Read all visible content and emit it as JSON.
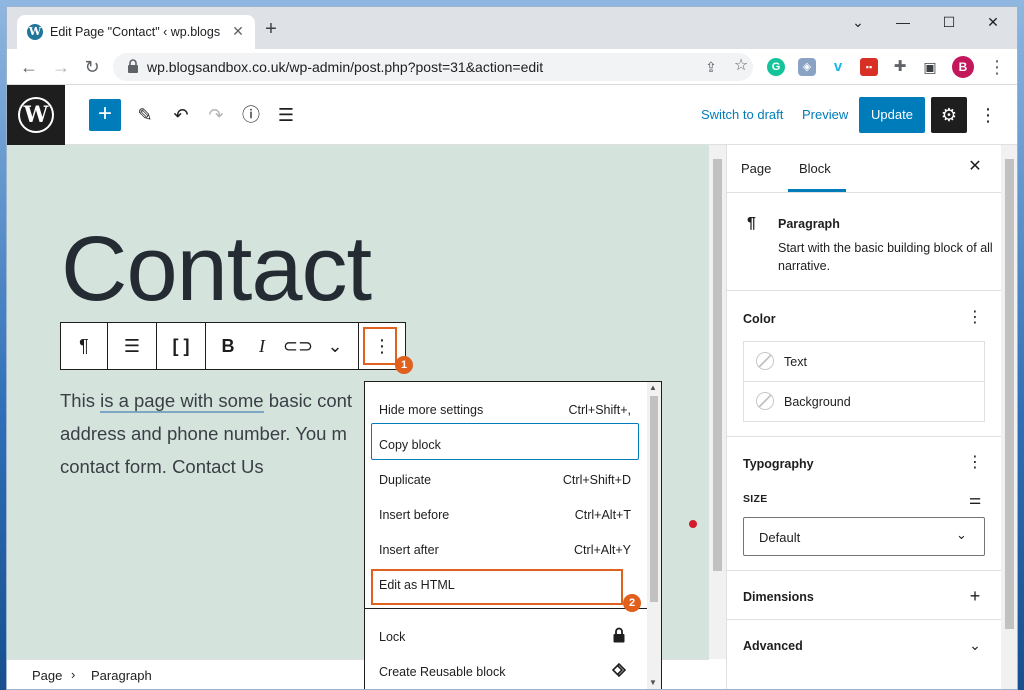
{
  "browser": {
    "tab_title": "Edit Page \"Contact\" ‹ wp.blogsan",
    "url": "wp.blogsandbox.co.uk/wp-admin/post.php?post=31&action=edit",
    "profile_initial": "B",
    "extensions": [
      "grammarly-icon",
      "shield-icon",
      "vimeo-icon",
      "red-ext-icon",
      "puzzle-icon",
      "sidebar-icon"
    ]
  },
  "header": {
    "switch_to_draft": "Switch to draft",
    "preview": "Preview",
    "update": "Update"
  },
  "content": {
    "title": "Contact",
    "para_pre": "This ",
    "para_link": "is a page with some",
    "para_post": " basic cont",
    "para_line2": "address and phone number. You m",
    "para_line3": "contact form. Contact Us"
  },
  "menu": {
    "items": [
      {
        "label": "Hide more settings",
        "shortcut": "Ctrl+Shift+,"
      },
      {
        "label": "Copy block",
        "shortcut": ""
      },
      {
        "label": "Duplicate",
        "shortcut": "Ctrl+Shift+D"
      },
      {
        "label": "Insert before",
        "shortcut": "Ctrl+Alt+T"
      },
      {
        "label": "Insert after",
        "shortcut": "Ctrl+Alt+Y"
      },
      {
        "label": "Edit as HTML",
        "shortcut": ""
      },
      {
        "label": "Lock",
        "shortcut": ""
      },
      {
        "label": "Create Reusable block",
        "shortcut": ""
      }
    ]
  },
  "annotations": {
    "badge1": "1",
    "badge2": "2"
  },
  "breadcrumb": {
    "page": "Page",
    "block": "Paragraph"
  },
  "sidebar": {
    "tab_page": "Page",
    "tab_block": "Block",
    "block_name": "Paragraph",
    "block_desc": "Start with the basic building block of all narrative.",
    "color_heading": "Color",
    "color_text": "Text",
    "color_background": "Background",
    "typography_heading": "Typography",
    "size_label": "SIZE",
    "size_value": "Default",
    "dimensions_heading": "Dimensions",
    "advanced_heading": "Advanced"
  },
  "colors": {
    "accent": "#007cba",
    "annotation": "#e0601d",
    "canvas": "#d4e4dc"
  }
}
